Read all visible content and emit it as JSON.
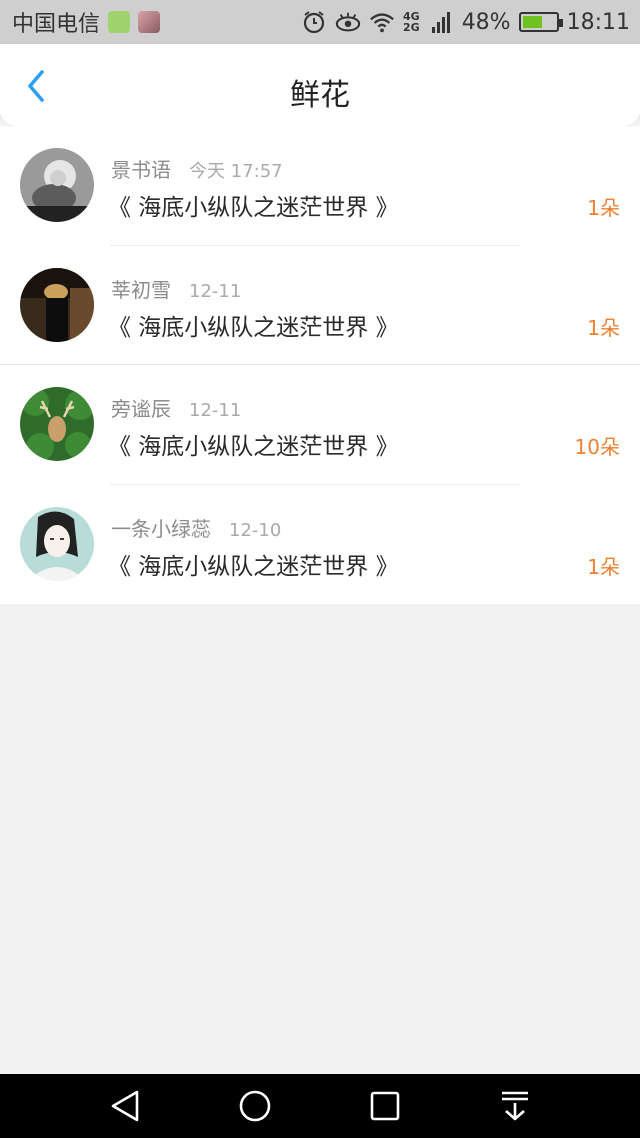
{
  "status_bar": {
    "carrier": "中国电信",
    "network": "4G 2G",
    "battery": "48%",
    "time": "18:11"
  },
  "header": {
    "title": "鲜花",
    "back_icon": "chevron-left-icon",
    "accent_color": "#2a9df4"
  },
  "gifts": [
    {
      "user": "景书语",
      "time": "今天 17:57",
      "book": "《 海底小纵队之迷茫世界 》",
      "count": "1朵"
    },
    {
      "user": "莘初雪",
      "time": "12-11",
      "book": "《 海底小纵队之迷茫世界 》",
      "count": "1朵"
    },
    {
      "user": "旁谧辰",
      "time": "12-11",
      "book": "《 海底小纵队之迷茫世界 》",
      "count": "10朵"
    },
    {
      "user": "一条小绿蕊",
      "time": "12-10",
      "book": "《 海底小纵队之迷茫世界 》",
      "count": "1朵"
    }
  ],
  "colors": {
    "count": "#f08030",
    "username": "#8c8c8c",
    "background": "#f2f2f2"
  },
  "nav": {
    "icons": [
      "back-triangle-icon",
      "home-circle-icon",
      "recents-square-icon",
      "notification-down-icon"
    ]
  }
}
